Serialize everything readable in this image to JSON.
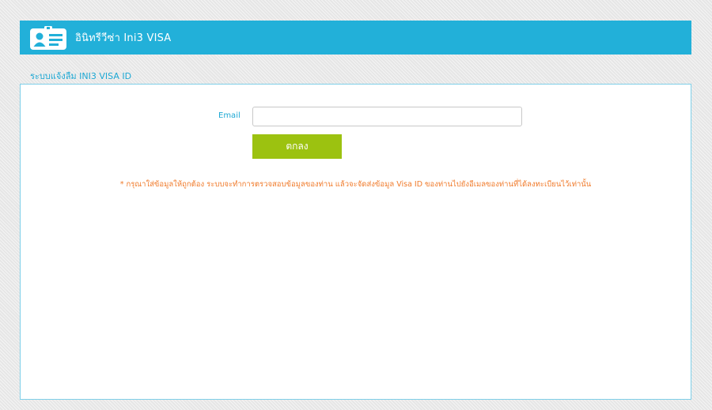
{
  "header": {
    "icon": "id-card-icon",
    "title": "อินิทรีวีซ่า Ini3 VISA"
  },
  "section": {
    "title": "ระบบแจ้งลืม INI3 VISA ID"
  },
  "form": {
    "email_label": "Email",
    "email_value": "",
    "submit_label": "ตกลง"
  },
  "notice": "* กรุณาใส่ข้อมูลให้ถูกต้อง ระบบจะทำการตรวจสอบข้อมูลของท่าน แล้วจะจัดส่งข้อมูล Visa ID ของท่านไปยังอีเมลของท่านที่ได้ลงทะเบียนไว้เท่านั้น",
  "colors": {
    "header_bg": "#22b0d9",
    "accent_text": "#1da8d4",
    "button_bg": "#9cc210",
    "notice_text": "#f07a2a"
  }
}
